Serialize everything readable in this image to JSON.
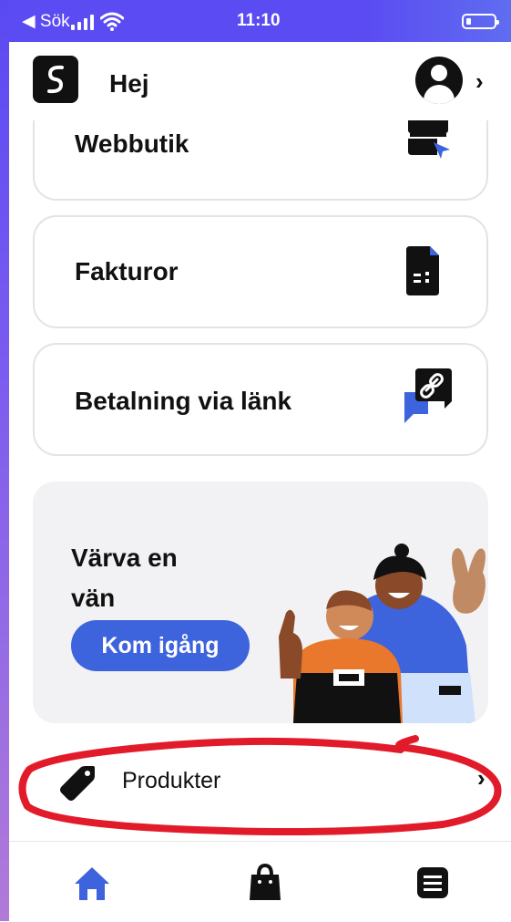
{
  "status_bar": {
    "back_label": "◀ Sök",
    "time": "11:10"
  },
  "header": {
    "title": "Hej",
    "profile_chevron": "›"
  },
  "cards": [
    {
      "label": "Webbutik",
      "icon": "storefront-icon"
    },
    {
      "label": "Fakturor",
      "icon": "invoice-icon"
    },
    {
      "label": "Betalning via länk",
      "icon": "link-chat-icon"
    }
  ],
  "promo": {
    "title": "Värva en vän",
    "button_label": "Kom igång"
  },
  "list": {
    "label": "Produkter",
    "icon": "tag-icon",
    "chevron": "›"
  },
  "tabs": [
    {
      "name": "home",
      "icon": "home-icon",
      "active": true
    },
    {
      "name": "shop",
      "icon": "shopping-bag-icon",
      "active": false
    },
    {
      "name": "menu",
      "icon": "menu-list-icon",
      "active": false
    }
  ],
  "colors": {
    "status_bar": "#5b4bf2",
    "accent": "#3d63dd",
    "annotation": "#e21b2a"
  }
}
